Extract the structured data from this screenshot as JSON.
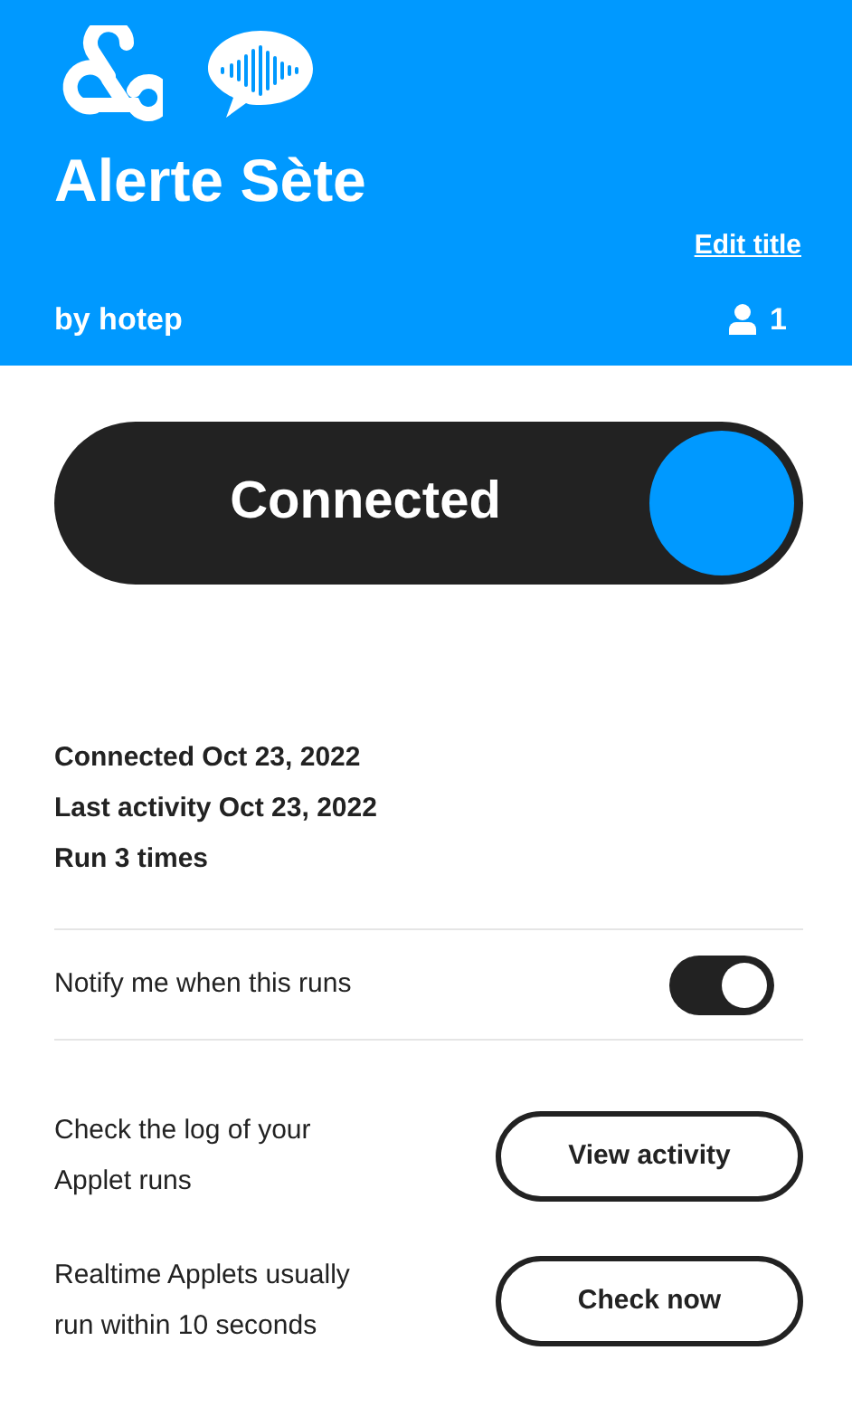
{
  "header": {
    "title": "Alerte Sète",
    "edit_link": "Edit title",
    "author": "by hotep",
    "user_count": "1"
  },
  "connection": {
    "label": "Connected",
    "on": true
  },
  "stats": [
    "Connected Oct 23, 2022",
    "Last activity Oct 23, 2022",
    "Run 3 times"
  ],
  "notify": {
    "label": "Notify me when this runs",
    "on": true
  },
  "actions": [
    {
      "text": "Check the log of your Applet runs",
      "button": "View activity"
    },
    {
      "text": "Realtime Applets usually run within 10 seconds",
      "button": "Check now"
    }
  ]
}
